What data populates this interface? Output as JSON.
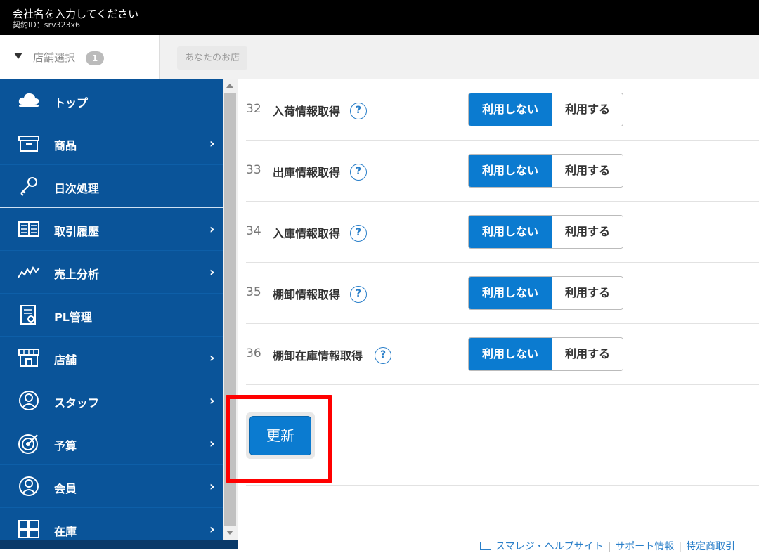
{
  "header": {
    "company": "会社名を入力してください",
    "contract_id": "契約ID：srv323x6"
  },
  "store_bar": {
    "select_label": "店舗選択",
    "count": "1",
    "store_chip": "あなたのお店"
  },
  "sidebar": {
    "items": [
      {
        "label": "トップ",
        "icon": "cloud-icon",
        "chevron": ""
      },
      {
        "label": "商品",
        "icon": "box-icon",
        "chevron": "›"
      },
      {
        "label": "日次処理",
        "icon": "key-icon",
        "chevron": ""
      },
      {
        "label": "取引履歴",
        "icon": "book-icon",
        "chevron": "›"
      },
      {
        "label": "売上分析",
        "icon": "chart-line-icon",
        "chevron": "›"
      },
      {
        "label": "PL管理",
        "icon": "report-icon",
        "chevron": ""
      },
      {
        "label": "店舗",
        "icon": "store-icon",
        "chevron": "›"
      },
      {
        "label": "スタッフ",
        "icon": "person-icon",
        "chevron": "›"
      },
      {
        "label": "予算",
        "icon": "target-icon",
        "chevron": "›"
      },
      {
        "label": "会員",
        "icon": "member-icon",
        "chevron": "›"
      },
      {
        "label": "在庫",
        "icon": "grid-icon",
        "chevron": "›"
      }
    ]
  },
  "settings": {
    "rows": [
      {
        "num": "32",
        "name": "入荷情報取得",
        "off": "利用しない",
        "on": "利用する"
      },
      {
        "num": "33",
        "name": "出庫情報取得",
        "off": "利用しない",
        "on": "利用する"
      },
      {
        "num": "34",
        "name": "入庫情報取得",
        "off": "利用しない",
        "on": "利用する"
      },
      {
        "num": "35",
        "name": "棚卸情報取得",
        "off": "利用しない",
        "on": "利用する"
      },
      {
        "num": "36",
        "name": "棚卸在庫情報取得",
        "off": "利用しない",
        "on": "利用する"
      }
    ],
    "help": "?",
    "update_label": "更新"
  },
  "footer": {
    "help_site": "スマレジ・ヘルプサイト",
    "support": "サポート情報",
    "tokusho": "特定商取引"
  },
  "colors": {
    "sidebar": "#0a5499",
    "accent": "#0b7bd0",
    "highlight": "#ff0000"
  }
}
